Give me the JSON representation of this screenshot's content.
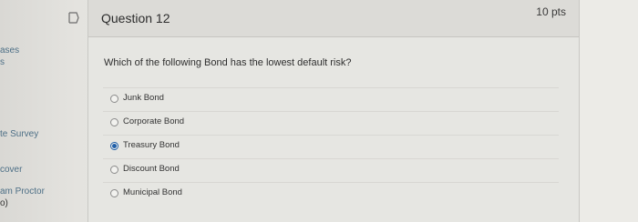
{
  "sidebar": {
    "items": [
      {
        "label": "ases"
      },
      {
        "label": "s"
      },
      {
        "label": "te Survey"
      },
      {
        "label": "cover"
      },
      {
        "label": "am Proctor"
      },
      {
        "label": "o)"
      }
    ]
  },
  "question": {
    "title": "Question 12",
    "points": "10 pts",
    "text": "Which of the following Bond has the lowest default risk?",
    "options": [
      {
        "label": "Junk Bond",
        "selected": false
      },
      {
        "label": "Corporate Bond",
        "selected": false
      },
      {
        "label": "Treasury Bond",
        "selected": true
      },
      {
        "label": "Discount Bond",
        "selected": false
      },
      {
        "label": "Municipal Bond",
        "selected": false
      }
    ]
  },
  "colors": {
    "accent": "#1f5fa8",
    "link": "#4d6f86"
  },
  "icons": {
    "flag": "flag-icon"
  }
}
